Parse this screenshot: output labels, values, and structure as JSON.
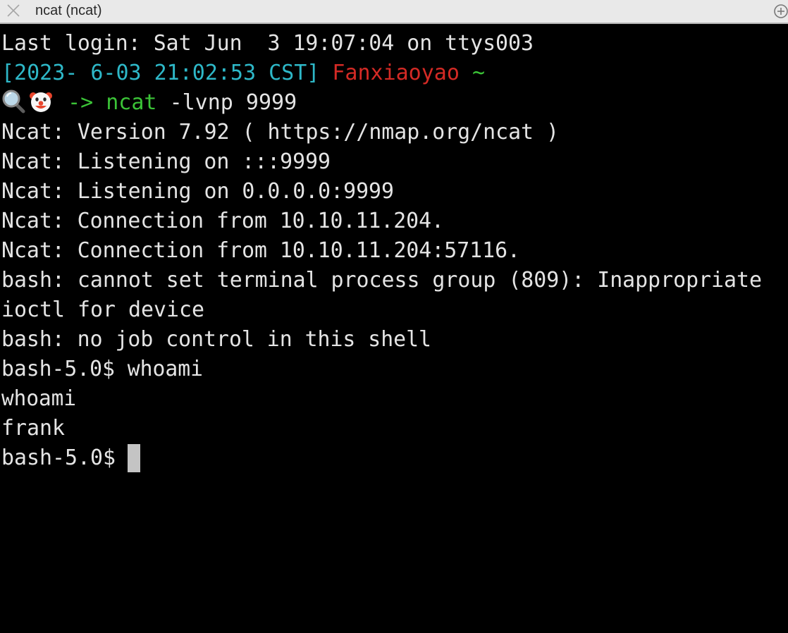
{
  "window": {
    "tab_title": "ncat (ncat)",
    "close_icon": "close-icon",
    "add_icon": "new-tab-icon"
  },
  "colors": {
    "background": "#000000",
    "text": "#e4e4e4",
    "timestamp": "#2eb8c8",
    "hostname": "#d42a25",
    "prompt": "#3bc337",
    "cursor": "#c4c4c4"
  },
  "terminal": {
    "last_login": "Last login: Sat Jun  3 19:07:04 on ttys003",
    "prompt": {
      "timestamp": "[2023- 6-03 21:02:53 CST]",
      "hostname": "Fanxiaoyao",
      "tilde": "~",
      "icons": [
        "magnifier-emoji-icon",
        "clown-face-emoji-icon"
      ],
      "arrow": "->",
      "command_name": "ncat",
      "command_args": "-lvnp 9999"
    },
    "output": [
      "Ncat: Version 7.92 ( https://nmap.org/ncat )",
      "Ncat: Listening on :::9999",
      "Ncat: Listening on 0.0.0.0:9999",
      "Ncat: Connection from 10.10.11.204.",
      "Ncat: Connection from 10.10.11.204:57116.",
      "bash: cannot set terminal process group (809): Inappropriate",
      "ioctl for device",
      "bash: no job control in this shell",
      "bash-5.0$ whoami",
      "whoami",
      "frank"
    ],
    "current_prompt": "bash-5.0$"
  }
}
